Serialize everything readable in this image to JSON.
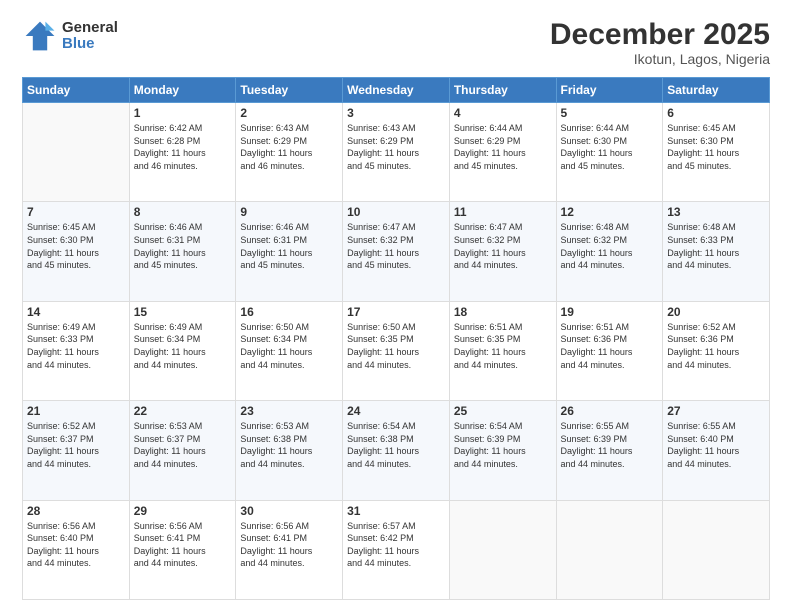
{
  "logo": {
    "text1": "General",
    "text2": "Blue"
  },
  "title": "December 2025",
  "subtitle": "Ikotun, Lagos, Nigeria",
  "weekdays": [
    "Sunday",
    "Monday",
    "Tuesday",
    "Wednesday",
    "Thursday",
    "Friday",
    "Saturday"
  ],
  "weeks": [
    [
      {
        "day": "",
        "info": ""
      },
      {
        "day": "1",
        "info": "Sunrise: 6:42 AM\nSunset: 6:28 PM\nDaylight: 11 hours\nand 46 minutes."
      },
      {
        "day": "2",
        "info": "Sunrise: 6:43 AM\nSunset: 6:29 PM\nDaylight: 11 hours\nand 46 minutes."
      },
      {
        "day": "3",
        "info": "Sunrise: 6:43 AM\nSunset: 6:29 PM\nDaylight: 11 hours\nand 45 minutes."
      },
      {
        "day": "4",
        "info": "Sunrise: 6:44 AM\nSunset: 6:29 PM\nDaylight: 11 hours\nand 45 minutes."
      },
      {
        "day": "5",
        "info": "Sunrise: 6:44 AM\nSunset: 6:30 PM\nDaylight: 11 hours\nand 45 minutes."
      },
      {
        "day": "6",
        "info": "Sunrise: 6:45 AM\nSunset: 6:30 PM\nDaylight: 11 hours\nand 45 minutes."
      }
    ],
    [
      {
        "day": "7",
        "info": "Sunrise: 6:45 AM\nSunset: 6:30 PM\nDaylight: 11 hours\nand 45 minutes."
      },
      {
        "day": "8",
        "info": "Sunrise: 6:46 AM\nSunset: 6:31 PM\nDaylight: 11 hours\nand 45 minutes."
      },
      {
        "day": "9",
        "info": "Sunrise: 6:46 AM\nSunset: 6:31 PM\nDaylight: 11 hours\nand 45 minutes."
      },
      {
        "day": "10",
        "info": "Sunrise: 6:47 AM\nSunset: 6:32 PM\nDaylight: 11 hours\nand 45 minutes."
      },
      {
        "day": "11",
        "info": "Sunrise: 6:47 AM\nSunset: 6:32 PM\nDaylight: 11 hours\nand 44 minutes."
      },
      {
        "day": "12",
        "info": "Sunrise: 6:48 AM\nSunset: 6:32 PM\nDaylight: 11 hours\nand 44 minutes."
      },
      {
        "day": "13",
        "info": "Sunrise: 6:48 AM\nSunset: 6:33 PM\nDaylight: 11 hours\nand 44 minutes."
      }
    ],
    [
      {
        "day": "14",
        "info": "Sunrise: 6:49 AM\nSunset: 6:33 PM\nDaylight: 11 hours\nand 44 minutes."
      },
      {
        "day": "15",
        "info": "Sunrise: 6:49 AM\nSunset: 6:34 PM\nDaylight: 11 hours\nand 44 minutes."
      },
      {
        "day": "16",
        "info": "Sunrise: 6:50 AM\nSunset: 6:34 PM\nDaylight: 11 hours\nand 44 minutes."
      },
      {
        "day": "17",
        "info": "Sunrise: 6:50 AM\nSunset: 6:35 PM\nDaylight: 11 hours\nand 44 minutes."
      },
      {
        "day": "18",
        "info": "Sunrise: 6:51 AM\nSunset: 6:35 PM\nDaylight: 11 hours\nand 44 minutes."
      },
      {
        "day": "19",
        "info": "Sunrise: 6:51 AM\nSunset: 6:36 PM\nDaylight: 11 hours\nand 44 minutes."
      },
      {
        "day": "20",
        "info": "Sunrise: 6:52 AM\nSunset: 6:36 PM\nDaylight: 11 hours\nand 44 minutes."
      }
    ],
    [
      {
        "day": "21",
        "info": "Sunrise: 6:52 AM\nSunset: 6:37 PM\nDaylight: 11 hours\nand 44 minutes."
      },
      {
        "day": "22",
        "info": "Sunrise: 6:53 AM\nSunset: 6:37 PM\nDaylight: 11 hours\nand 44 minutes."
      },
      {
        "day": "23",
        "info": "Sunrise: 6:53 AM\nSunset: 6:38 PM\nDaylight: 11 hours\nand 44 minutes."
      },
      {
        "day": "24",
        "info": "Sunrise: 6:54 AM\nSunset: 6:38 PM\nDaylight: 11 hours\nand 44 minutes."
      },
      {
        "day": "25",
        "info": "Sunrise: 6:54 AM\nSunset: 6:39 PM\nDaylight: 11 hours\nand 44 minutes."
      },
      {
        "day": "26",
        "info": "Sunrise: 6:55 AM\nSunset: 6:39 PM\nDaylight: 11 hours\nand 44 minutes."
      },
      {
        "day": "27",
        "info": "Sunrise: 6:55 AM\nSunset: 6:40 PM\nDaylight: 11 hours\nand 44 minutes."
      }
    ],
    [
      {
        "day": "28",
        "info": "Sunrise: 6:56 AM\nSunset: 6:40 PM\nDaylight: 11 hours\nand 44 minutes."
      },
      {
        "day": "29",
        "info": "Sunrise: 6:56 AM\nSunset: 6:41 PM\nDaylight: 11 hours\nand 44 minutes."
      },
      {
        "day": "30",
        "info": "Sunrise: 6:56 AM\nSunset: 6:41 PM\nDaylight: 11 hours\nand 44 minutes."
      },
      {
        "day": "31",
        "info": "Sunrise: 6:57 AM\nSunset: 6:42 PM\nDaylight: 11 hours\nand 44 minutes."
      },
      {
        "day": "",
        "info": ""
      },
      {
        "day": "",
        "info": ""
      },
      {
        "day": "",
        "info": ""
      }
    ]
  ]
}
